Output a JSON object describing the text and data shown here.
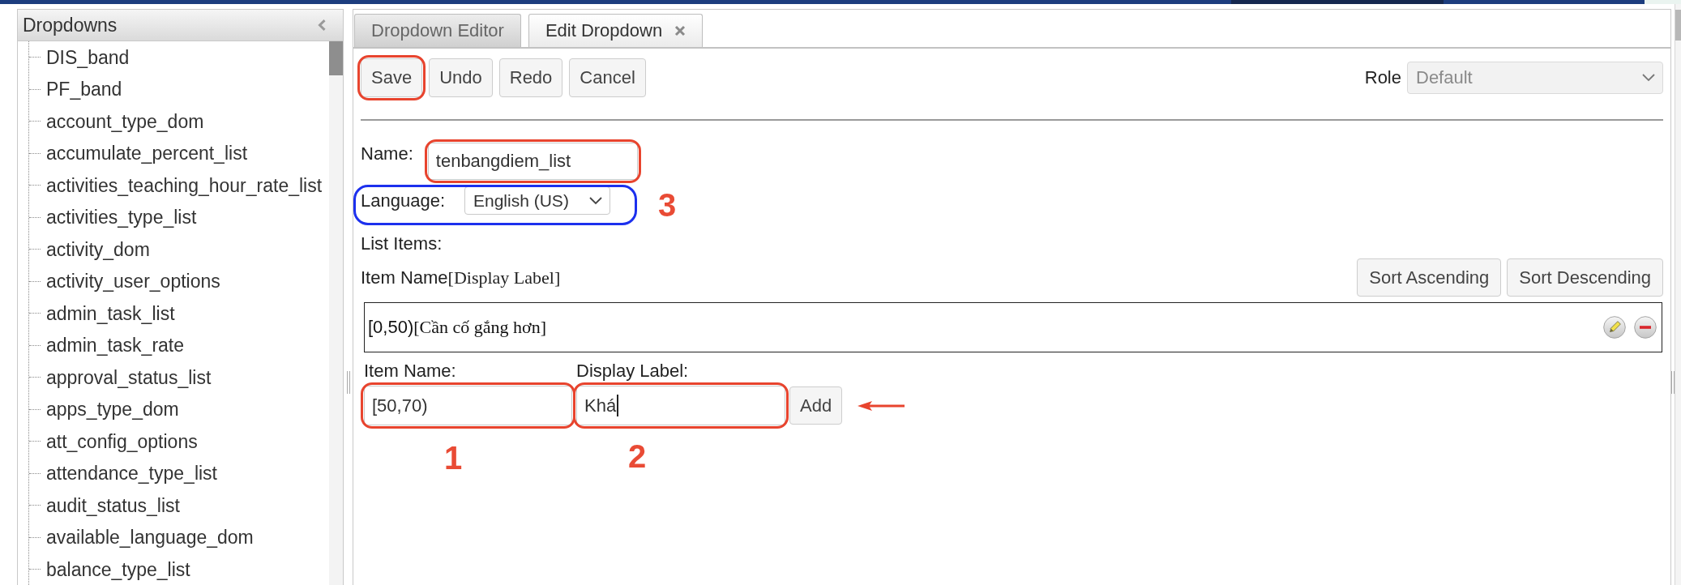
{
  "sidebar": {
    "title": "Dropdowns",
    "items": [
      "DIS_band",
      "PF_band",
      "account_type_dom",
      "accumulate_percent_list",
      "activities_teaching_hour_rate_list",
      "activities_type_list",
      "activity_dom",
      "activity_user_options",
      "admin_task_list",
      "admin_task_rate",
      "approval_status_list",
      "apps_type_dom",
      "att_config_options",
      "attendance_type_list",
      "audit_status_list",
      "available_language_dom",
      "balance_type_list"
    ]
  },
  "tabs": [
    {
      "label": "Dropdown Editor",
      "selected": false,
      "closable": false
    },
    {
      "label": "Edit Dropdown",
      "selected": true,
      "closable": true
    }
  ],
  "toolbar": {
    "buttons": [
      {
        "label": "Save",
        "highlight": {
          "color": "#e8442e"
        }
      },
      {
        "label": "Undo"
      },
      {
        "label": "Redo"
      },
      {
        "label": "Cancel"
      }
    ],
    "role": {
      "label": "Role",
      "value": "Default",
      "disabled": true
    }
  },
  "form": {
    "name": {
      "label": "Name:",
      "value": "tenbangdiem_list",
      "highlight": {
        "color": "#e8442e"
      }
    },
    "language": {
      "label": "Language:",
      "value": "English (US)",
      "highlight": {
        "color": "#1c30ee"
      },
      "callout": "3"
    }
  },
  "list": {
    "title": "List Items:",
    "caption": {
      "name_part": "Item Name",
      "label_part": "[Display Label]"
    },
    "sort_buttons": [
      "Sort Ascending",
      "Sort Descending"
    ],
    "items": [
      {
        "name": "[0,50)",
        "label": "[Cần cố gắng hơn]"
      }
    ]
  },
  "new_item": {
    "name_field": {
      "label": "Item Name:",
      "value": "[50,70)",
      "highlight": {
        "color": "#e8442e"
      },
      "callout": "1"
    },
    "label_field": {
      "label": "Display Label:",
      "value": "Khá",
      "highlight": {
        "color": "#e8442e"
      },
      "callout": "2",
      "focused": true
    },
    "add_button": {
      "label": "Add",
      "pointer_arrow": true
    }
  }
}
